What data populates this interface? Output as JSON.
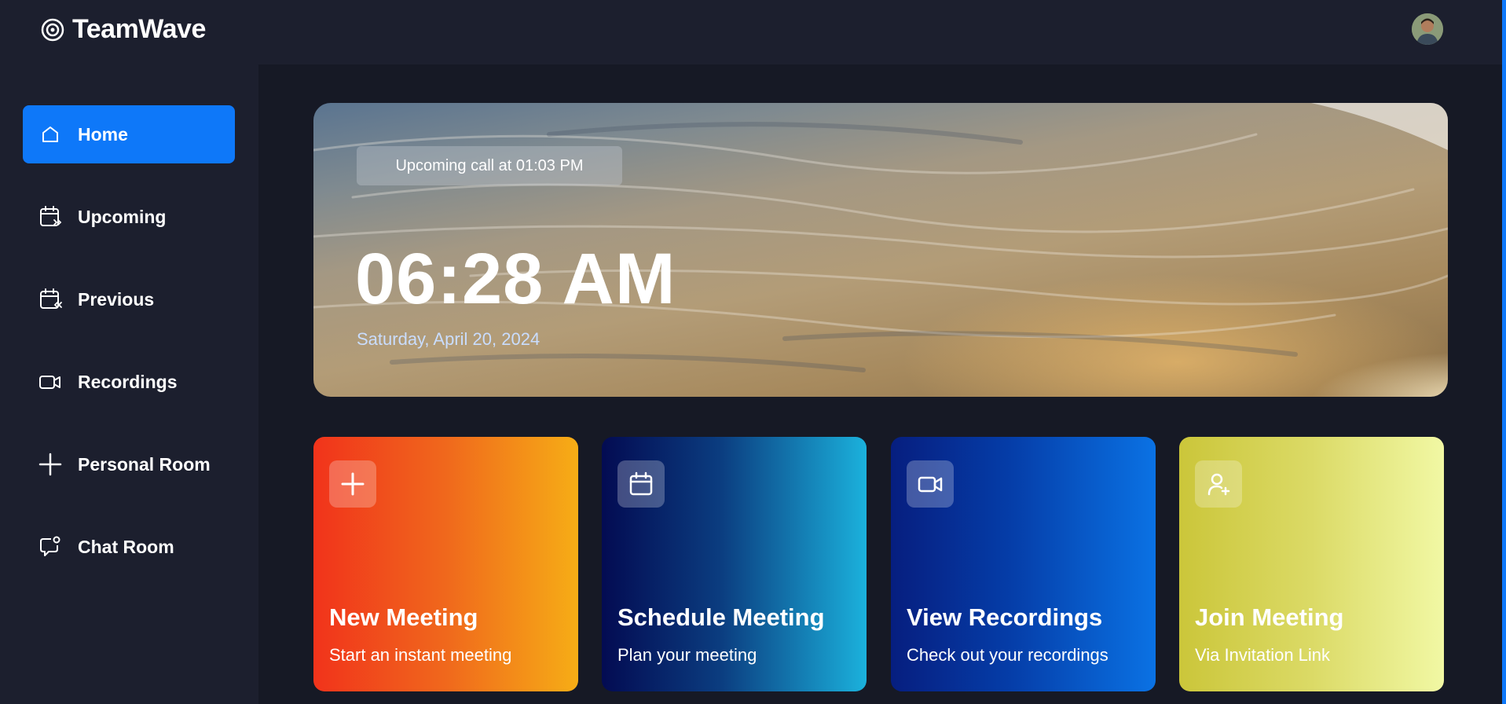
{
  "app": {
    "name": "TeamWave"
  },
  "sidebar": {
    "items": [
      {
        "label": "Home",
        "icon": "home-icon",
        "active": true
      },
      {
        "label": "Upcoming",
        "icon": "calendar-upcoming-icon",
        "active": false
      },
      {
        "label": "Previous",
        "icon": "calendar-previous-icon",
        "active": false
      },
      {
        "label": "Recordings",
        "icon": "video-icon",
        "active": false
      },
      {
        "label": "Personal Room",
        "icon": "plus-icon",
        "active": false
      },
      {
        "label": "Chat Room",
        "icon": "chat-icon",
        "active": false
      }
    ]
  },
  "hero": {
    "badge": "Upcoming call at 01:03 PM",
    "time": "06:28 AM",
    "date": "Saturday, April 20, 2024"
  },
  "cards": [
    {
      "title": "New Meeting",
      "subtitle": "Start an instant meeting",
      "icon": "plus-icon"
    },
    {
      "title": "Schedule Meeting",
      "subtitle": "Plan your meeting",
      "icon": "calendar-icon"
    },
    {
      "title": "View Recordings",
      "subtitle": "Check out your recordings",
      "icon": "video-icon"
    },
    {
      "title": "Join Meeting",
      "subtitle": "Via Invitation Link",
      "icon": "user-plus-icon"
    }
  ],
  "colors": {
    "accent": "#0e78f9",
    "background": "#161925",
    "panel": "#1c1f2e"
  }
}
